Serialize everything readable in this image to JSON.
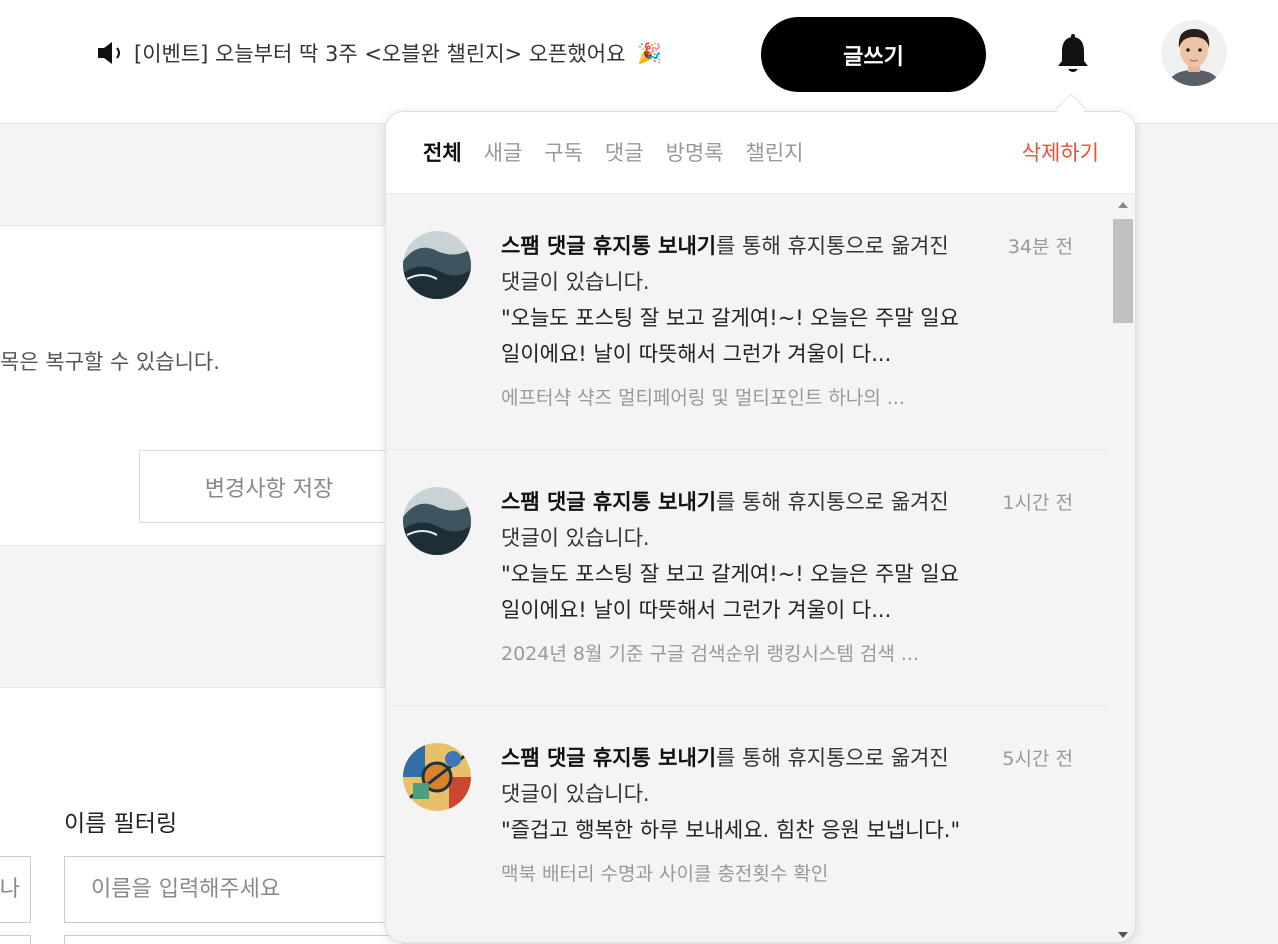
{
  "header": {
    "notice_text": "[이벤트] 오늘부터 딱 3주 <오블완 챌린지> 오픈했어요",
    "notice_emoji": "🎉",
    "write_button": "글쓰기",
    "icons": {
      "speaker": "speaker-icon",
      "bell": "bell-icon",
      "avatar": "user-avatar"
    }
  },
  "page": {
    "description_fragment": "목은 복구할 수 있습니다.",
    "save_button": "변경사항 저장",
    "filter_label": "이름 필터링",
    "name_placeholder": "이름을 입력해주세요",
    "left_input_fragment": "나"
  },
  "notifications": {
    "tabs": [
      "전체",
      "새글",
      "구독",
      "댓글",
      "방명록",
      "챌린지"
    ],
    "active_tab": "전체",
    "delete_all": "삭제하기",
    "items": [
      {
        "bold": "스팸 댓글 휴지통 보내기",
        "text": "를 통해 휴지통으로 옮겨진 댓글이 있습니다.",
        "quote": "\"오늘도 포스팅 잘 보고 갈게여!~! 오늘은 주말 일요일이에요! 날이 따뜻해서 그런가 겨울이 다...",
        "source": "에프터�châ 샥즈 멀티페어링 및 멀티포인트 하나의 ...",
        "time": "34분 전"
      },
      {
        "bold": "스팸 댓글 휴지통 보내기",
        "text": "를 통해 휴지통으로 옮겨진 댓글이 있습니다.",
        "quote": "\"오늘도 포스팅 잘 보고 갈게여!~! 오늘은 주말 일요일이에요! 날이 따뜻해서 그런가 겨울이 다...",
        "source": "2024년 8월 기준 구글 검색순위 랭킹시스템 검색 ...",
        "time": "1시간 전"
      },
      {
        "bold": "스팸 댓글 휴지통 보내기",
        "text": "를 통해 휴지통으로 옮겨진 댓글이 있습니다.",
        "quote": "\"즐겁고 행복한 하루 보내세요. 힘찬 응원 보냅니다.\"",
        "source": "맥북 배터리 수명과 사이클 충전횟수 확인",
        "time": "5시간 전"
      }
    ]
  }
}
